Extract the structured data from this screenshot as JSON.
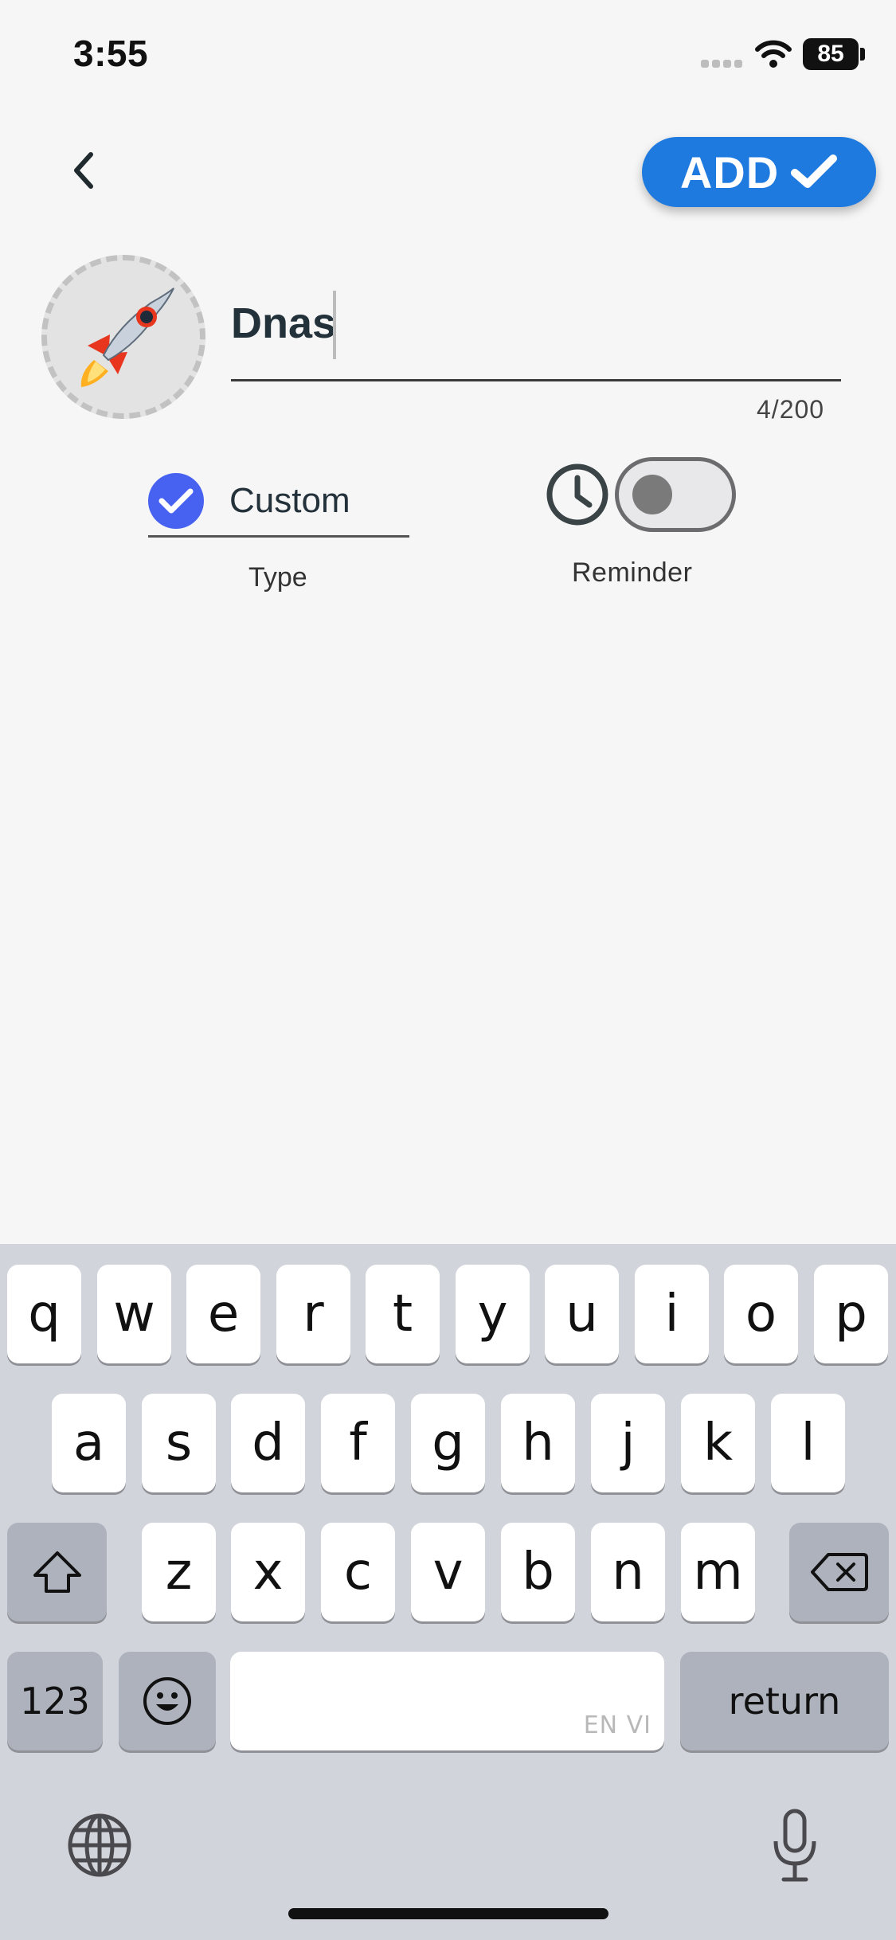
{
  "status_bar": {
    "time": "3:55",
    "battery": "85"
  },
  "header": {
    "add_label": "ADD"
  },
  "name_field": {
    "value": "Dnas",
    "char_count": "4/200"
  },
  "type": {
    "value": "Custom",
    "label": "Type"
  },
  "reminder": {
    "label": "Reminder",
    "enabled": false
  },
  "keyboard": {
    "row1": [
      "q",
      "w",
      "e",
      "r",
      "t",
      "y",
      "u",
      "i",
      "o",
      "p"
    ],
    "row2": [
      "a",
      "s",
      "d",
      "f",
      "g",
      "h",
      "j",
      "k",
      "l"
    ],
    "row3": [
      "z",
      "x",
      "c",
      "v",
      "b",
      "n",
      "m"
    ],
    "numbers_key": "123",
    "return_key": "return",
    "space_hint": "EN VI"
  },
  "colors": {
    "accent": "#1f7ae0",
    "type_check": "#4761f0",
    "background": "#f6f6f6"
  }
}
